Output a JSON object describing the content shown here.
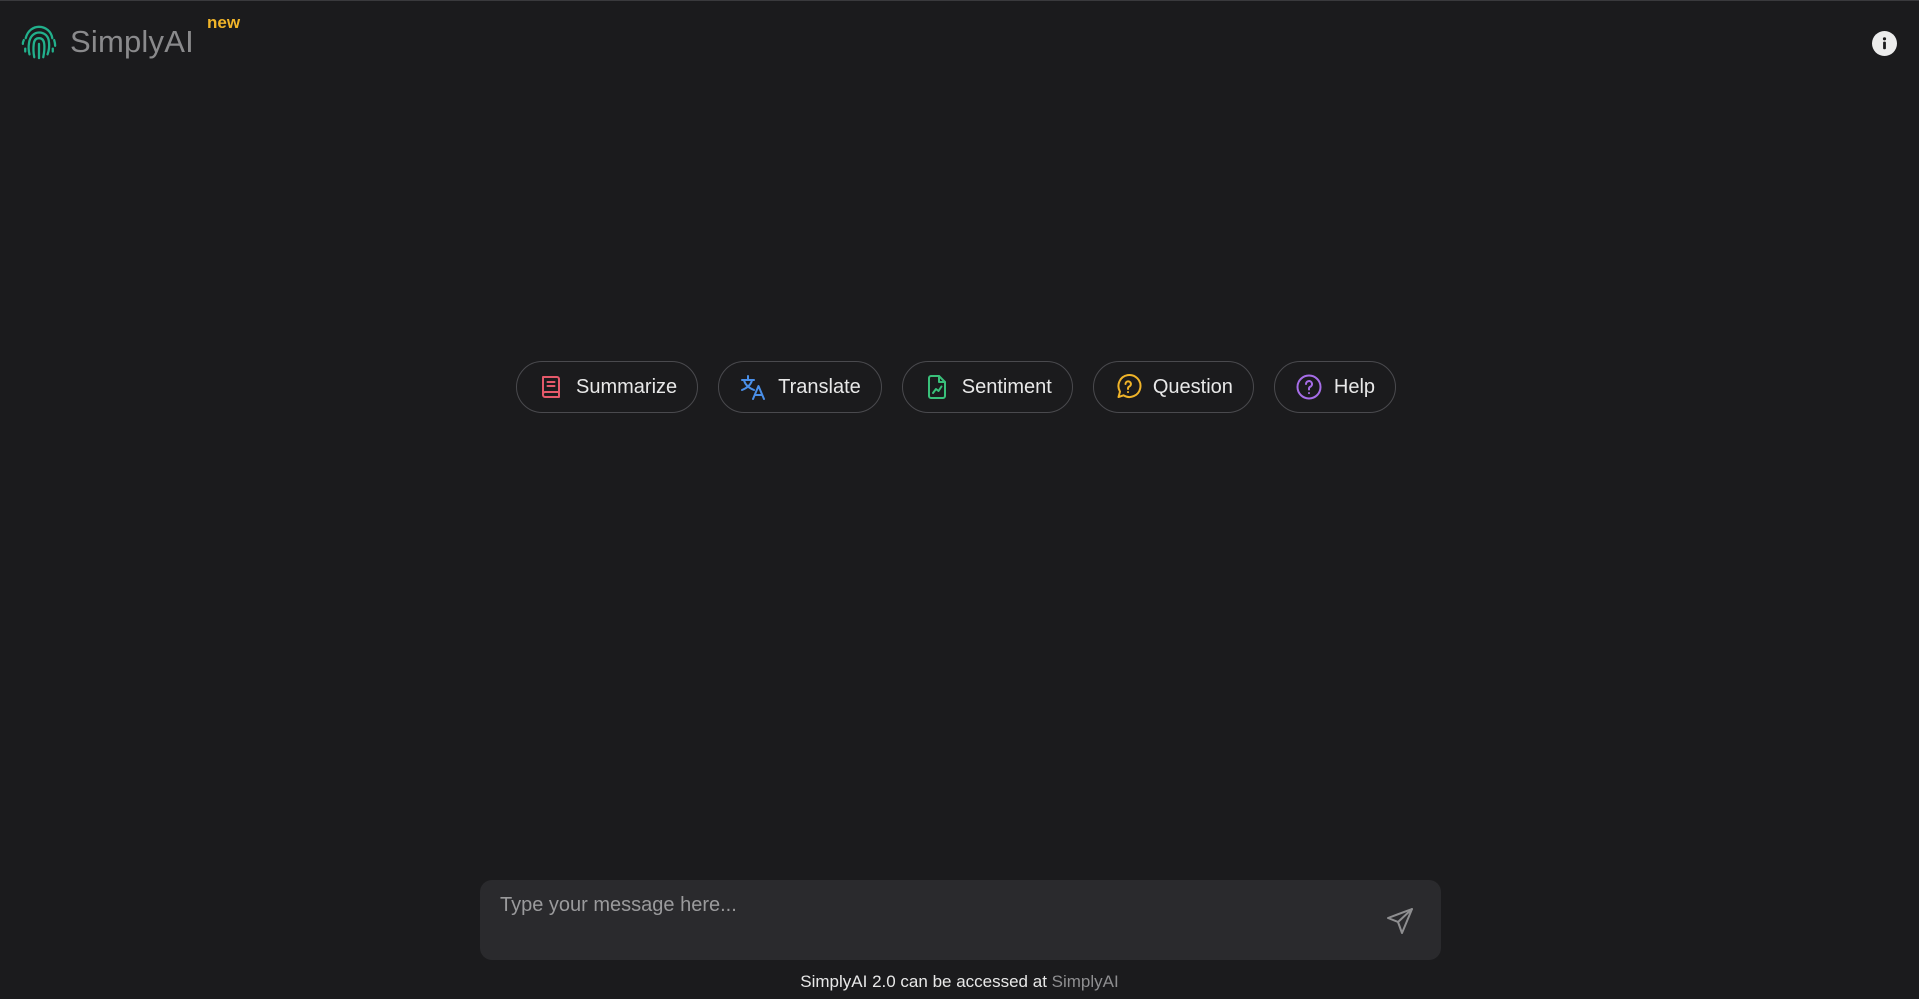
{
  "header": {
    "app_name": "SimplyAI",
    "badge": "new",
    "logo_icon": "fingerprint-icon",
    "info_icon": "info-icon"
  },
  "actions": [
    {
      "label": "Summarize",
      "icon": "book-icon",
      "color": "#e5596a"
    },
    {
      "label": "Translate",
      "icon": "translate-icon",
      "color": "#4a8fe8"
    },
    {
      "label": "Sentiment",
      "icon": "file-chart-icon",
      "color": "#39c07a"
    },
    {
      "label": "Question",
      "icon": "question-bubble-icon",
      "color": "#f0b429"
    },
    {
      "label": "Help",
      "icon": "help-circle-icon",
      "color": "#a66de8"
    }
  ],
  "composer": {
    "placeholder": "Type your message here...",
    "send_icon": "send-icon"
  },
  "footer": {
    "text": "SimplyAI 2.0 can be accessed at ",
    "link_text": "SimplyAI"
  },
  "colors": {
    "background": "#1b1b1d",
    "accent_logo": "#22b08c",
    "badge": "#f0b429"
  }
}
